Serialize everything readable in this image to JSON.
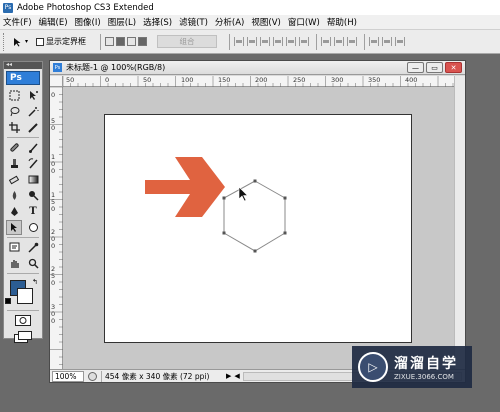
{
  "window": {
    "title": "Adobe Photoshop CS3 Extended",
    "logo_text": "Ps"
  },
  "menu": [
    "文件(F)",
    "编辑(E)",
    "图像(I)",
    "图层(L)",
    "选择(S)",
    "滤镜(T)",
    "分析(A)",
    "视图(V)",
    "窗口(W)",
    "帮助(H)"
  ],
  "options_bar": {
    "show_bounding_box_label": "显示定界框",
    "show_bounding_box_checked": false,
    "combine_label": "组合"
  },
  "toolbox": {
    "logo": "Ps",
    "collapse_glyph": "◂◂"
  },
  "document": {
    "title": "未标题-1 @ 100%(RGB/8)",
    "ruler_h_labels": [
      "50",
      "0",
      "50",
      "100",
      "150",
      "200",
      "250",
      "300",
      "350",
      "400"
    ],
    "ruler_v_labels": [
      "0",
      "5",
      "0",
      "1",
      "0",
      "0",
      "1",
      "5",
      "0",
      "2",
      "0",
      "0",
      "2",
      "5",
      "0",
      "3",
      "0",
      "0"
    ],
    "zoom": "100%",
    "status": "454 像素 x 340 像素 (72 ppi)"
  },
  "canvas_shapes": {
    "arrow_color": "#e06340",
    "path_shape": "hexagon"
  },
  "watermark": {
    "brand": "溜溜自学",
    "site": "ZIXUE.3066.COM"
  }
}
